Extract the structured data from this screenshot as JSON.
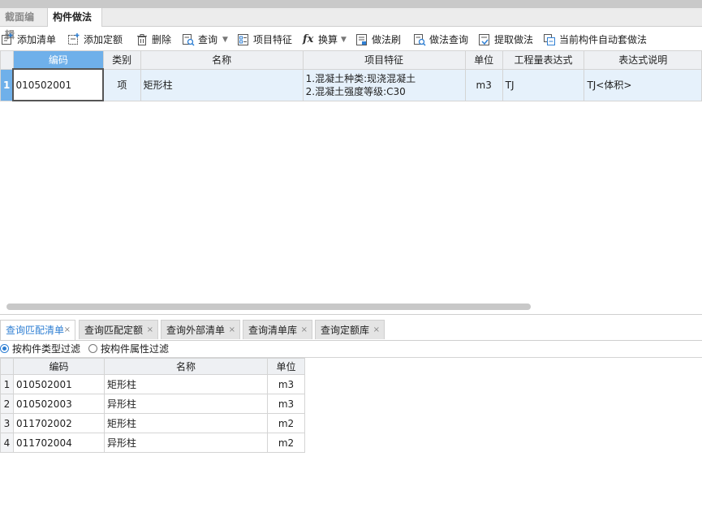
{
  "top_tabs": [
    {
      "label": "截面编辑",
      "active": false
    },
    {
      "label": "构件做法",
      "active": true
    }
  ],
  "toolbar": {
    "add_list": "添加清单",
    "add_quota": "添加定额",
    "delete": "删除",
    "query": "查询",
    "item_feature": "项目特征",
    "convert": "换算",
    "method_brush": "做法刷",
    "method_query": "做法查询",
    "extract_method": "提取做法",
    "auto_apply": "当前构件自动套做法"
  },
  "main_table": {
    "columns": [
      "编码",
      "类别",
      "名称",
      "项目特征",
      "单位",
      "工程量表达式",
      "表达式说明"
    ],
    "rows": [
      {
        "num": "1",
        "code": "010502001",
        "category": "项",
        "name": "矩形柱",
        "features": [
          "1.混凝土种类:现浇混凝土",
          "2.混凝土强度等级:C30"
        ],
        "unit": "m3",
        "expression": "TJ",
        "expression_desc": "TJ<体积>"
      }
    ]
  },
  "bottom_tabs": [
    {
      "label": "查询匹配清单",
      "active": true
    },
    {
      "label": "查询匹配定额",
      "active": false
    },
    {
      "label": "查询外部清单",
      "active": false
    },
    {
      "label": "查询清单库",
      "active": false
    },
    {
      "label": "查询定额库",
      "active": false
    }
  ],
  "close_glyph": "×",
  "filters": {
    "by_type": "按构件类型过滤",
    "by_attr": "按构件属性过滤",
    "selected": "by_type"
  },
  "sub_table": {
    "columns": [
      "编码",
      "名称",
      "单位"
    ],
    "rows": [
      {
        "num": "1",
        "code": "010502001",
        "name": "矩形柱",
        "unit": "m3"
      },
      {
        "num": "2",
        "code": "010502003",
        "name": "异形柱",
        "unit": "m3"
      },
      {
        "num": "3",
        "code": "011702002",
        "name": "矩形柱",
        "unit": "m2"
      },
      {
        "num": "4",
        "code": "011702004",
        "name": "异形柱",
        "unit": "m2"
      }
    ]
  },
  "colors": {
    "selected_header": "#6fb0ea",
    "row_highlight": "#e6f1fb",
    "active_tab_text": "#2f7fd3"
  }
}
